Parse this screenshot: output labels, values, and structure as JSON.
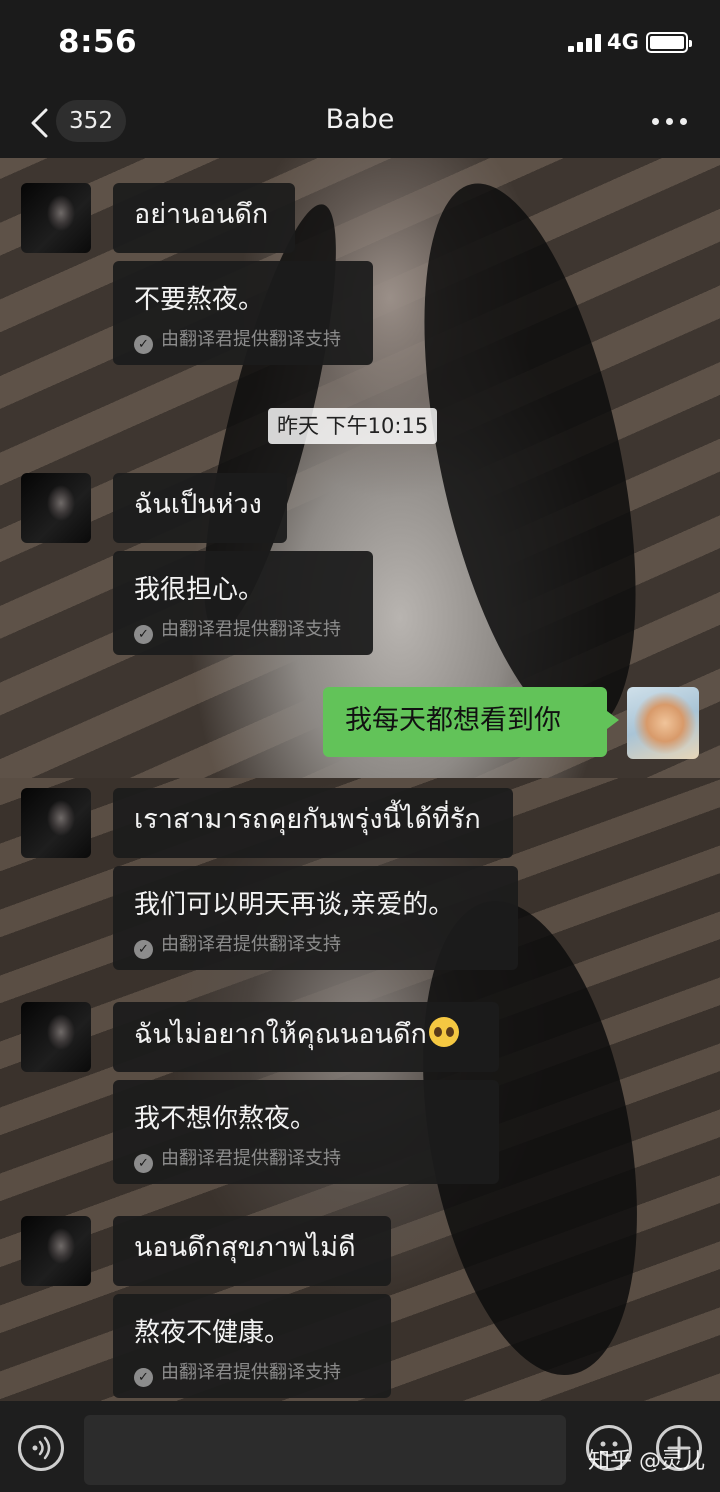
{
  "status_bar": {
    "time": "8:56",
    "network": "4G"
  },
  "nav": {
    "unread_count": "352",
    "title": "Babe"
  },
  "credit_label": "由翻译君提供翻译支持",
  "messages": [
    {
      "original": "อย่านอนดึก",
      "translation": "不要熬夜。"
    },
    {
      "original": "ฉันเป็นห่วง",
      "translation": "我很担心。"
    },
    {
      "original": "เราสามารถคุยกันพรุ่งนี้ได้ที่รัก",
      "translation": "我们可以明天再谈,亲爱的。"
    },
    {
      "original": "ฉันไม่อยากให้คุณนอนดึก",
      "translation": "我不想你熬夜。",
      "emoji": "pleading-face"
    },
    {
      "original": "นอนดึกสุขภาพไม่ดี",
      "translation": "熬夜不健康。"
    }
  ],
  "timestamp": "昨天 下午10:15",
  "self_message": "我每天都想看到你",
  "watermark": "知乎 @灵儿",
  "colors": {
    "self_bubble": "#62c359",
    "bubble": "#1c1c1c",
    "bar": "#1b1b1b"
  }
}
